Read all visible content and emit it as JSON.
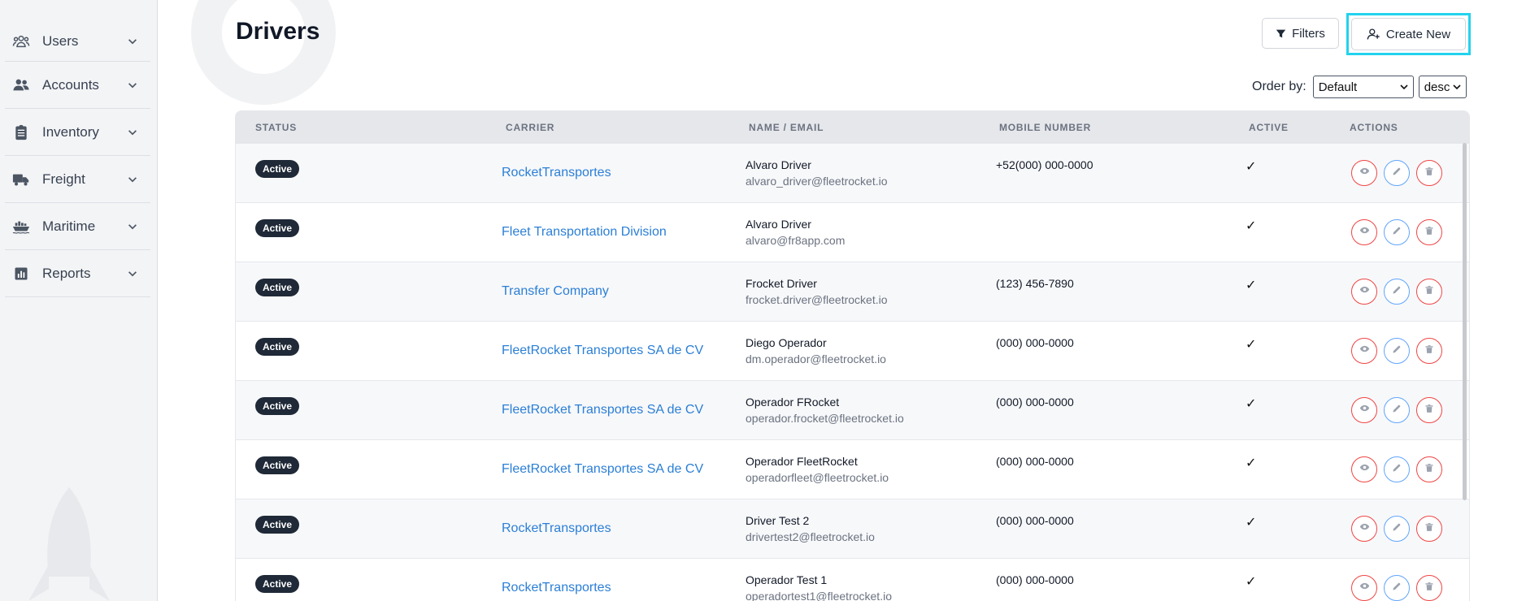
{
  "sidebar": {
    "items": [
      {
        "label": "Users",
        "icon": "users-icon"
      },
      {
        "label": "Accounts",
        "icon": "accounts-icon"
      },
      {
        "label": "Inventory",
        "icon": "clipboard-icon"
      },
      {
        "label": "Freight",
        "icon": "truck-icon"
      },
      {
        "label": "Maritime",
        "icon": "ship-icon"
      },
      {
        "label": "Reports",
        "icon": "chart-icon"
      }
    ]
  },
  "header": {
    "title": "Drivers",
    "filters_label": "Filters",
    "create_label": "Create New"
  },
  "order": {
    "label": "Order by:",
    "sort_value": "Default",
    "dir_value": "desc"
  },
  "table": {
    "columns": [
      "STATUS",
      "CARRIER",
      "NAME / EMAIL",
      "MOBILE NUMBER",
      "ACTIVE",
      "ACTIONS"
    ],
    "rows": [
      {
        "status": "Active",
        "carrier": "RocketTransportes",
        "name": "Alvaro Driver",
        "email": "alvaro_driver@fleetrocket.io",
        "mobile": "+52(000) 000-0000",
        "active": "✓"
      },
      {
        "status": "Active",
        "carrier": "Fleet Transportation Division",
        "name": "Alvaro Driver",
        "email": "alvaro@fr8app.com",
        "mobile": "",
        "active": "✓"
      },
      {
        "status": "Active",
        "carrier": "Transfer Company",
        "name": "Frocket Driver",
        "email": "frocket.driver@fleetrocket.io",
        "mobile": "(123) 456-7890",
        "active": "✓"
      },
      {
        "status": "Active",
        "carrier": "FleetRocket Transportes SA de CV",
        "name": "Diego Operador",
        "email": "dm.operador@fleetrocket.io",
        "mobile": "(000) 000-0000",
        "active": "✓"
      },
      {
        "status": "Active",
        "carrier": "FleetRocket Transportes SA de CV",
        "name": "Operador FRocket",
        "email": "operador.frocket@fleetrocket.io",
        "mobile": "(000) 000-0000",
        "active": "✓"
      },
      {
        "status": "Active",
        "carrier": "FleetRocket Transportes SA de CV",
        "name": "Operador FleetRocket",
        "email": "operadorfleet@fleetrocket.io",
        "mobile": "(000) 000-0000",
        "active": "✓"
      },
      {
        "status": "Active",
        "carrier": "RocketTransportes",
        "name": "Driver Test 2",
        "email": "drivertest2@fleetrocket.io",
        "mobile": "(000) 000-0000",
        "active": "✓"
      },
      {
        "status": "Active",
        "carrier": "RocketTransportes",
        "name": "Operador Test 1",
        "email": "operadortest1@fleetrocket.io",
        "mobile": "(000) 000-0000",
        "active": "✓"
      }
    ]
  },
  "colors": {
    "accent_link": "#2b7fd6",
    "badge_bg": "#1f2937",
    "highlight_border": "#22d3ee",
    "view_delete": "#ef4444",
    "edit": "#60a5fa"
  }
}
